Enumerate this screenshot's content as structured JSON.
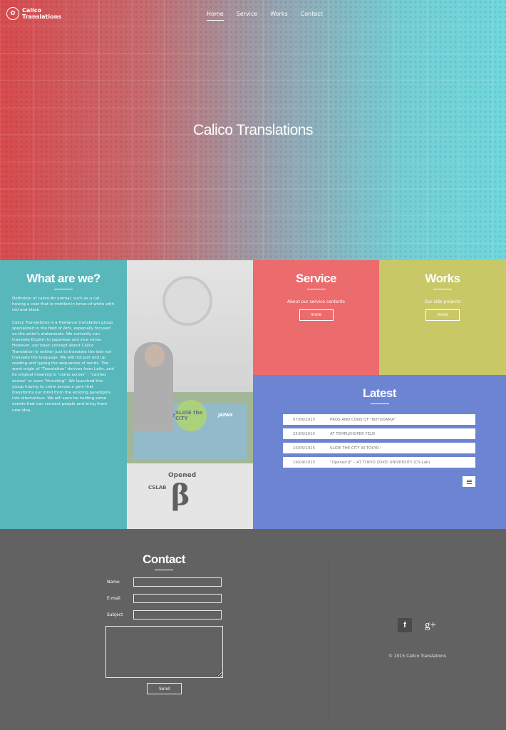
{
  "header": {
    "logo_line1": "Calico",
    "logo_line2": "Translations",
    "logo_glyph": "✿",
    "nav": [
      {
        "label": "Home",
        "active": true
      },
      {
        "label": "Service",
        "active": false
      },
      {
        "label": "Works",
        "active": false
      },
      {
        "label": "Contact",
        "active": false
      }
    ]
  },
  "hero": {
    "title": "Calico Translations"
  },
  "about": {
    "title": "What are we?",
    "paragraph1": "Definition of calico:An animal, such as a cat, having a coat that is mottled in tones of white with red and black.",
    "paragraph2": "Calico Translations is a freelance translation group specialized in the field of Arts, especially focused on the artist's statements. We currently can translate English to Japanese and vice versa. However, our basic concept about Calico Translation is neither just to translate the text nor translate the language. We will not just end up reading and typing the sequences of words. The word origin of \"Translation\" derives from Latin, and its original meaning is \"come across\" , \"carried across\" or even \"thrusting\". We launched this group hoping to come across a gem that transforms our mind from the existing paradigms into alternatives. We will soon be holding some events that can connect people and bring them new idea."
  },
  "photo": {
    "slide_badge": "SLIDE the CITY",
    "banner_text": "Slide the City",
    "japan": "JAPAN",
    "opened": "Opened",
    "beta": "β",
    "cslab": "CSLAB"
  },
  "service": {
    "title": "Service",
    "subtitle": "About our service contents",
    "button": "more"
  },
  "works": {
    "title": "Works",
    "subtitle": "Our side projects",
    "button": "more"
  },
  "latest": {
    "title": "Latest",
    "items": [
      {
        "date": "07/06/2015",
        "title": "PROS AND CONS OF \"KOTODAMA\""
      },
      {
        "date": "25/05/2015",
        "title": "AT TEMPLEHOFER FELD"
      },
      {
        "date": "10/05/2015",
        "title": "SLIDE THE CITY IN TOKYO !"
      },
      {
        "date": "19/04/2015",
        "title": "\"Opened β\" – AT TOKYO ZOKEI UNIVERSITY (CS-Lab)"
      }
    ],
    "menu_icon": "hamburger-icon"
  },
  "contact": {
    "title": "Contact",
    "fields": [
      {
        "label": "Name"
      },
      {
        "label": "E-mail"
      },
      {
        "label": "Subject"
      }
    ],
    "send": "Send",
    "social": {
      "facebook": "f",
      "googleplus": "g+"
    },
    "copyright": "© 2015 Calico Translations"
  },
  "colors": {
    "about_bg": "#57b7bb",
    "service_bg": "#ec6b6c",
    "works_bg": "#c9c867",
    "latest_bg": "#6d84d3",
    "contact_bg": "#626262"
  }
}
